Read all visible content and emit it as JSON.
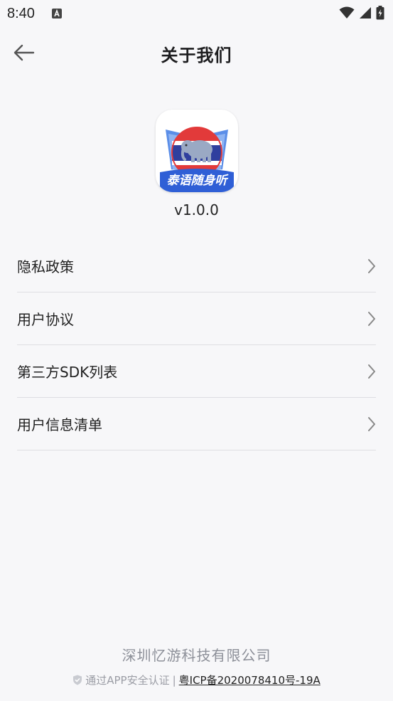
{
  "status_bar": {
    "time": "8:40"
  },
  "nav": {
    "title": "关于我们"
  },
  "app": {
    "icon_label": "泰语随身听",
    "version": "v1.0.0"
  },
  "menu": {
    "items": [
      {
        "label": "隐私政策"
      },
      {
        "label": "用户协议"
      },
      {
        "label": "第三方SDK列表"
      },
      {
        "label": "用户信息清单"
      }
    ]
  },
  "footer": {
    "company": "深圳忆游科技有限公司",
    "cert_text": "通过APP安全认证",
    "separator": "|",
    "icp": "粤ICP备2020078410号-19A"
  },
  "colors": {
    "background": "#f7f7f9",
    "divider": "#dedee2",
    "icon_blue": "#2f5fd6",
    "icon_red": "#e23a3a",
    "footer_gray": "#8d9099"
  }
}
